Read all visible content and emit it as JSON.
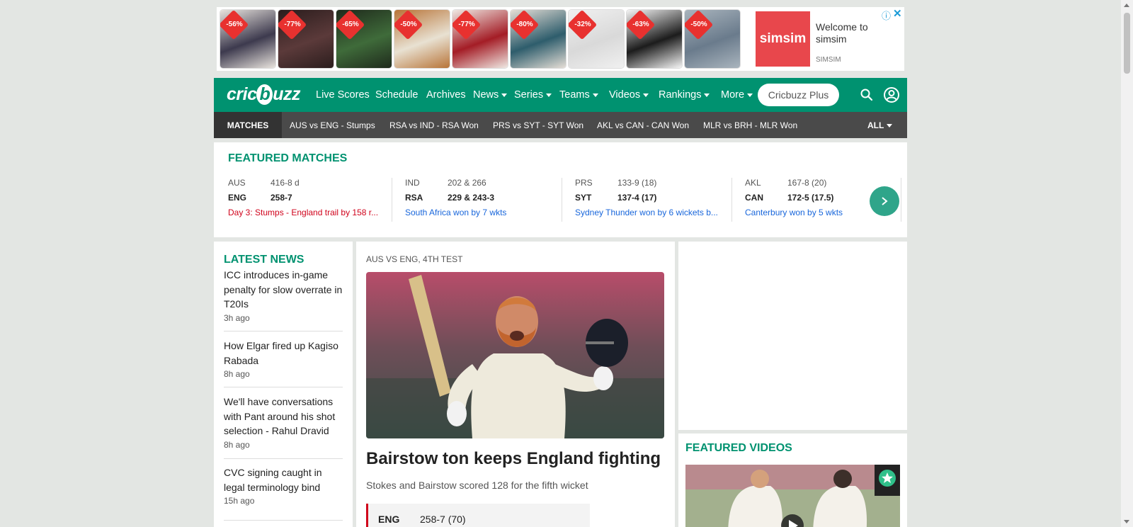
{
  "ad": {
    "products": [
      {
        "discount": "-56%",
        "colors": [
          "#3d3a4e",
          "#e9e4de"
        ]
      },
      {
        "discount": "-77%",
        "colors": [
          "#5b3a3a",
          "#2b1d1d"
        ]
      },
      {
        "discount": "-65%",
        "colors": [
          "#3f6b3a",
          "#1f2a1c"
        ]
      },
      {
        "discount": "-50%",
        "colors": [
          "#e8e1d2",
          "#b87438"
        ]
      },
      {
        "discount": "-77%",
        "colors": [
          "#a41d26",
          "#efe8e3"
        ]
      },
      {
        "discount": "-80%",
        "colors": [
          "#2e5d6c",
          "#e5ded6"
        ]
      },
      {
        "discount": "-32%",
        "colors": [
          "#d9d9d9",
          "#f0f0f0"
        ]
      },
      {
        "discount": "-63%",
        "colors": [
          "#1c1c1c",
          "#f5f5f5"
        ]
      },
      {
        "discount": "-50%",
        "colors": [
          "#6a7b8c",
          "#a9b4bd"
        ]
      }
    ],
    "brand": "simsim",
    "welcome": "Welcome to simsim",
    "sub": "SIMSIM",
    "info_icon": "info-icon",
    "close_icon": "close-icon"
  },
  "nav": {
    "logo": "cricbuzz",
    "items": [
      {
        "label": "Live Scores",
        "dropdown": false
      },
      {
        "label": "Schedule",
        "dropdown": false
      },
      {
        "label": "Archives",
        "dropdown": false
      },
      {
        "label": "News",
        "dropdown": true
      },
      {
        "label": "Series",
        "dropdown": true
      },
      {
        "label": "Teams",
        "dropdown": true
      },
      {
        "label": "Videos",
        "dropdown": true
      },
      {
        "label": "Rankings",
        "dropdown": true
      },
      {
        "label": "More",
        "dropdown": true
      }
    ],
    "plus_button": "Cricbuzz Plus",
    "search_icon": "search-icon",
    "user_icon": "user-icon",
    "color": "#009270"
  },
  "strip": {
    "tab": "MATCHES",
    "items": [
      "AUS vs ENG - Stumps",
      "RSA vs IND - RSA Won",
      "PRS vs SYT - SYT Won",
      "AKL vs CAN - CAN Won",
      "MLR vs BRH - MLR Won"
    ],
    "all": "ALL"
  },
  "featured": {
    "title": "FEATURED MATCHES",
    "matches": [
      {
        "t1": "AUS",
        "s1": "416-8 d",
        "t2": "ENG",
        "s2": "258-7",
        "result": "Day 3: Stumps - England trail by 158 r...",
        "result_color": "#d0021b",
        "bold": "t2"
      },
      {
        "t1": "IND",
        "s1": "202 & 266",
        "t2": "RSA",
        "s2": "229 & 243-3",
        "result": "South Africa won by 7 wkts",
        "result_color": "#1866db",
        "bold": "t2"
      },
      {
        "t1": "PRS",
        "s1": "133-9 (18)",
        "t2": "SYT",
        "s2": "137-4 (17)",
        "result": "Sydney Thunder won by 6 wickets b...",
        "result_color": "#1866db",
        "bold": "t2"
      },
      {
        "t1": "AKL",
        "s1": "167-8 (20)",
        "t2": "CAN",
        "s2": "172-5 (17.5)",
        "result": "Canterbury won by 5 wkts",
        "result_color": "#1866db",
        "bold": "t2"
      }
    ],
    "next_icon": "chevron-right-icon"
  },
  "news": {
    "title": "LATEST NEWS",
    "items": [
      {
        "title": "ICC introduces in-game penalty for slow overrate in T20Is",
        "time": "3h ago"
      },
      {
        "title": "How Elgar fired up Kagiso Rabada",
        "time": "8h ago"
      },
      {
        "title": "We'll have conversations with Pant around his shot selection - Rahul Dravid",
        "time": "8h ago"
      },
      {
        "title": "CVC signing caught in legal terminology bind",
        "time": "15h ago"
      }
    ]
  },
  "story": {
    "kicker": "AUS VS ENG, 4TH TEST",
    "headline": "Bairstow ton keeps England fighting",
    "intro": "Stokes and Bairstow scored 128 for the fifth wicket",
    "score_team": "ENG",
    "score_value": "258-7 (70)"
  },
  "videos": {
    "title": "FEATURED VIDEOS",
    "badge_icon": "star-icon",
    "play_icon": "play-icon"
  }
}
